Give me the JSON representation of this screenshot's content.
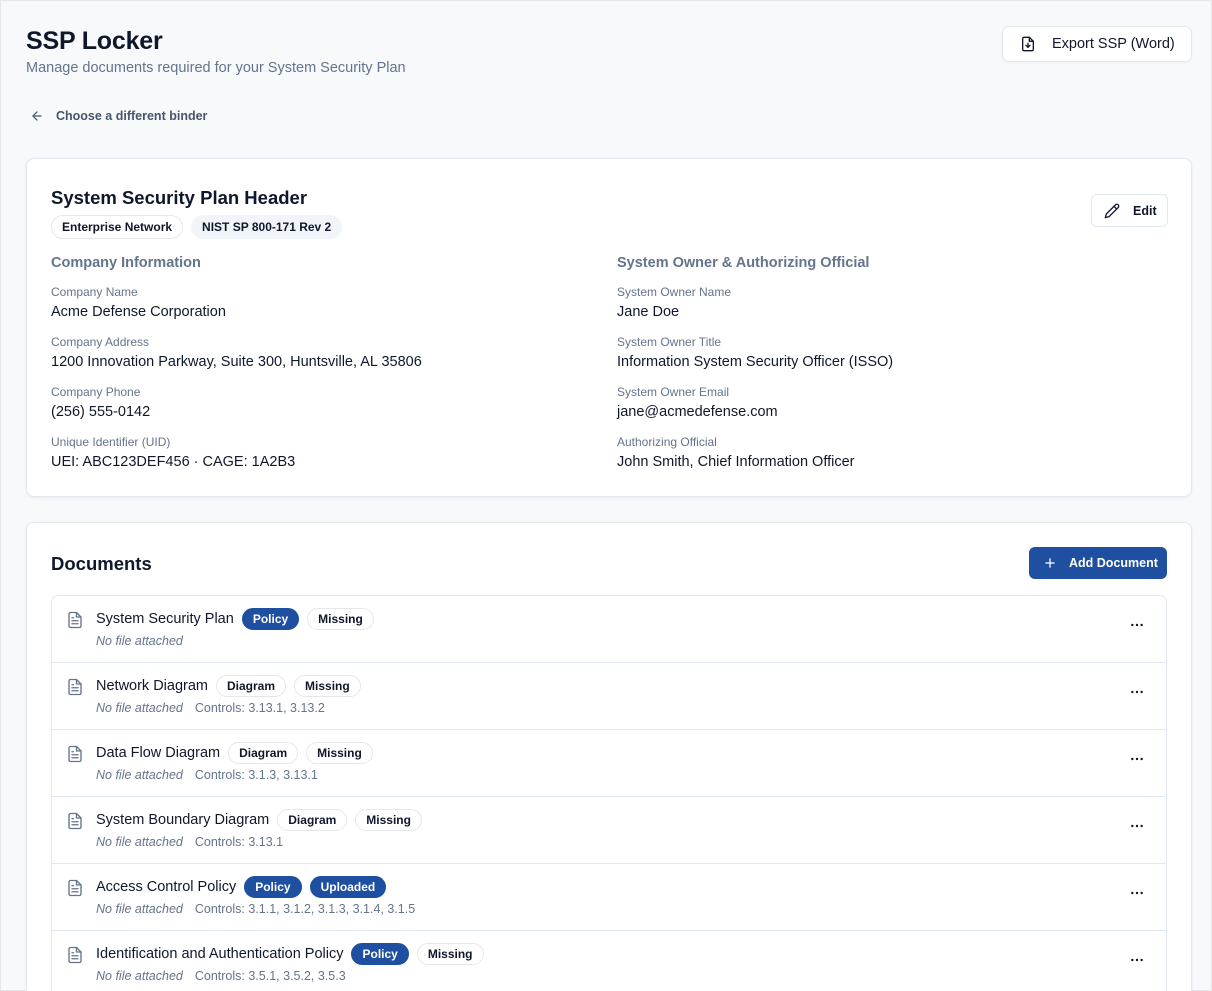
{
  "page": {
    "title": "SSP Locker",
    "subtitle": "Manage documents required for your System Security Plan",
    "export_label": "Export SSP (Word)",
    "back_label": "Choose a different binder"
  },
  "header_card": {
    "title": "System Security Plan Header",
    "tags": [
      "Enterprise Network",
      "NIST SP 800-171 Rev 2"
    ],
    "edit_label": "Edit",
    "company": {
      "heading": "Company Information",
      "fields": [
        {
          "label": "Company Name",
          "value": "Acme Defense Corporation"
        },
        {
          "label": "Company Address",
          "value": "1200 Innovation Parkway, Suite 300, Huntsville, AL 35806"
        },
        {
          "label": "Company Phone",
          "value": "(256) 555-0142"
        },
        {
          "label": "Unique Identifier (UID)",
          "value": "UEI: ABC123DEF456 · CAGE: 1A2B3"
        }
      ]
    },
    "owner": {
      "heading": "System Owner & Authorizing Official",
      "fields": [
        {
          "label": "System Owner Name",
          "value": "Jane Doe"
        },
        {
          "label": "System Owner Title",
          "value": "Information System Security Officer (ISSO)"
        },
        {
          "label": "System Owner Email",
          "value": "jane@acmedefense.com"
        },
        {
          "label": "Authorizing Official",
          "value": "John Smith, Chief Information Officer"
        }
      ]
    }
  },
  "documents": {
    "title": "Documents",
    "add_label": "Add Document",
    "items": [
      {
        "name": "System Security Plan",
        "type": "Policy",
        "status": "Missing",
        "file": "No file attached",
        "controls": ""
      },
      {
        "name": "Network Diagram",
        "type": "Diagram",
        "status": "Missing",
        "file": "No file attached",
        "controls": "Controls: 3.13.1, 3.13.2"
      },
      {
        "name": "Data Flow Diagram",
        "type": "Diagram",
        "status": "Missing",
        "file": "No file attached",
        "controls": "Controls: 3.1.3, 3.13.1"
      },
      {
        "name": "System Boundary Diagram",
        "type": "Diagram",
        "status": "Missing",
        "file": "No file attached",
        "controls": "Controls: 3.13.1"
      },
      {
        "name": "Access Control Policy",
        "type": "Policy",
        "status": "Uploaded",
        "file": "No file attached",
        "controls": "Controls: 3.1.1, 3.1.2, 3.1.3, 3.1.4, 3.1.5"
      },
      {
        "name": "Identification and Authentication Policy",
        "type": "Policy",
        "status": "Missing",
        "file": "No file attached",
        "controls": "Controls: 3.5.1, 3.5.2, 3.5.3"
      }
    ]
  },
  "colors": {
    "accent": "#1e4fa0",
    "muted_text": "#64748b",
    "border": "#e2e8f0"
  }
}
